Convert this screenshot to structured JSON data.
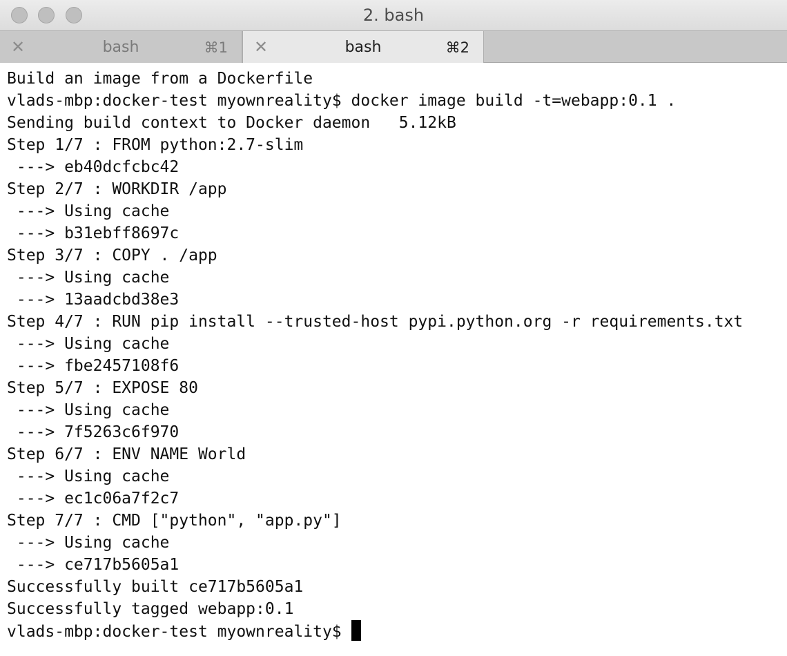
{
  "window": {
    "title": "2. bash"
  },
  "tabs": [
    {
      "close": "✕",
      "label": "bash",
      "shortcut": "⌘1",
      "active": false
    },
    {
      "close": "✕",
      "label": "bash",
      "shortcut": "⌘2",
      "active": true
    }
  ],
  "terminal": {
    "lines": [
      "Build an image from a Dockerfile",
      "vlads-mbp:docker-test myownreality$ docker image build -t=webapp:0.1 .",
      "Sending build context to Docker daemon   5.12kB",
      "Step 1/7 : FROM python:2.7-slim",
      " ---> eb40dcfcbc42",
      "Step 2/7 : WORKDIR /app",
      " ---> Using cache",
      " ---> b31ebff8697c",
      "Step 3/7 : COPY . /app",
      " ---> Using cache",
      " ---> 13aadcbd38e3",
      "Step 4/7 : RUN pip install --trusted-host pypi.python.org -r requirements.txt",
      " ---> Using cache",
      " ---> fbe2457108f6",
      "Step 5/7 : EXPOSE 80",
      " ---> Using cache",
      " ---> 7f5263c6f970",
      "Step 6/7 : ENV NAME World",
      " ---> Using cache",
      " ---> ec1c06a7f2c7",
      "Step 7/7 : CMD [\"python\", \"app.py\"]",
      " ---> Using cache",
      " ---> ce717b5605a1",
      "Successfully built ce717b5605a1",
      "Successfully tagged webapp:0.1"
    ],
    "prompt": "vlads-mbp:docker-test myownreality$ "
  },
  "colors": {
    "titlebar": "#dcdcdc",
    "tabbar_inactive": "#c8c8c8",
    "tab_active": "#e8e8e8",
    "terminal_bg": "#ffffff",
    "terminal_fg": "#111111"
  }
}
